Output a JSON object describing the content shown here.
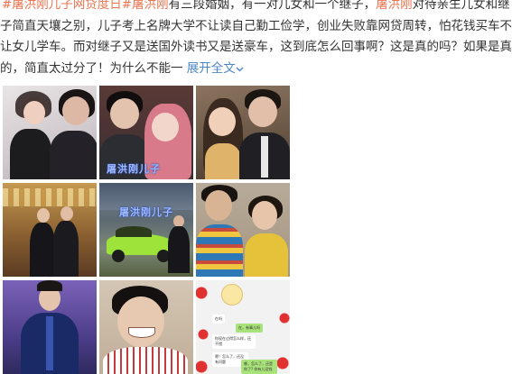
{
  "post": {
    "line1": {
      "tag1": "#屠洪刚儿子网贷度日#",
      "name1": "屠洪刚",
      "text": "有三段婚姻，有一对儿女和一个继子，",
      "name2": "屠洪刚",
      "text2": "对待亲生儿女和继"
    },
    "line2": "子简直天壤之别，儿子考上名牌大学不让读自己勤工俭学，创业失败靠网贷周转，怕花钱买车不",
    "line3": "让女儿学车。而对继子又是送国外读书又是送豪车，这到底怎么回事啊？这是真的吗？如果是真",
    "line4": {
      "text": "的，简直太过分了！为什么不能一",
      "expand": "展开全文",
      "expand_icon": "chevron-down-icon"
    }
  },
  "images": [
    {
      "name": "photo-1",
      "watermark": ""
    },
    {
      "name": "photo-2",
      "watermark": "屠洪刚儿子"
    },
    {
      "name": "photo-3",
      "watermark": ""
    },
    {
      "name": "photo-4",
      "watermark": ""
    },
    {
      "name": "photo-5",
      "watermark": "屠洪刚儿子"
    },
    {
      "name": "photo-6",
      "watermark": ""
    },
    {
      "name": "photo-7",
      "watermark": ""
    },
    {
      "name": "photo-8",
      "watermark": ""
    },
    {
      "name": "photo-9-chat-screenshot",
      "watermark": ""
    }
  ],
  "chat": {
    "b1": "在吗",
    "b2": "在，有事儿吗",
    "b3": "你现在过得怎么样，还不错",
    "b4": "嗯！怎么了，还没有问题",
    "b5": "哪，怎么了，还是你了? 你有儿没钱"
  },
  "colors": {
    "hashtag": "#eb7350",
    "link": "#4e87c7",
    "text": "#333333"
  }
}
